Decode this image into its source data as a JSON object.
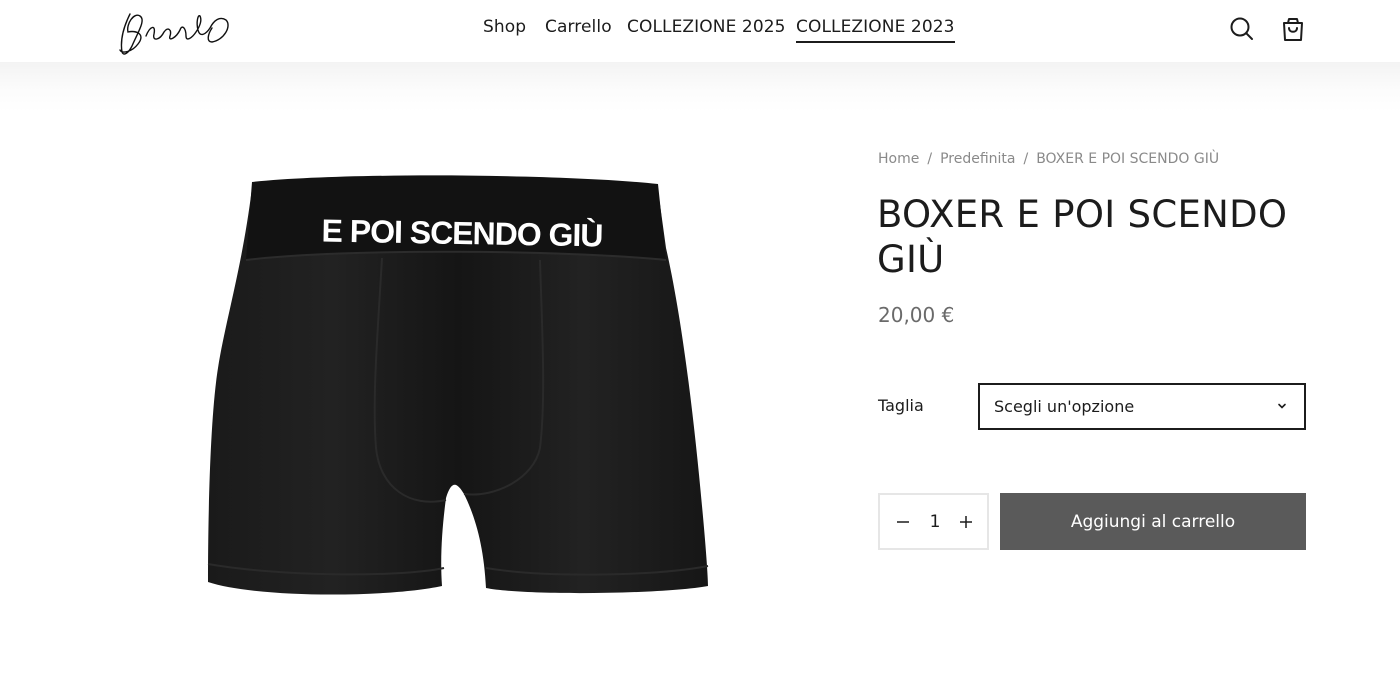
{
  "header": {
    "logo_alt": "Brooklyn",
    "nav": [
      {
        "label": "Shop",
        "active": false
      },
      {
        "label": "Carrello",
        "active": false
      },
      {
        "label": "COLLEZIONE 2025",
        "active": false
      },
      {
        "label": "COLLEZIONE 2023",
        "active": true
      }
    ],
    "icons": [
      "search-icon",
      "cart-icon"
    ]
  },
  "product": {
    "image_text": "E POI SCENDO GIÙ",
    "breadcrumb": [
      "Home",
      "Predefinita",
      "BOXER E POI SCENDO GIÙ"
    ],
    "title_line1": "BOXER E POI SCENDO",
    "title_line2": "GIÙ",
    "price": "20,00 €",
    "variation_label": "Taglia",
    "variation_value": "Scegli un'opzione",
    "quantity": "1",
    "add_to_cart": "Aggiungi al carrello"
  },
  "colors": {
    "button_bg": "#5a5a5a",
    "text": "#1c1c1c",
    "muted": "#8a8a8a",
    "product": "#141414"
  }
}
